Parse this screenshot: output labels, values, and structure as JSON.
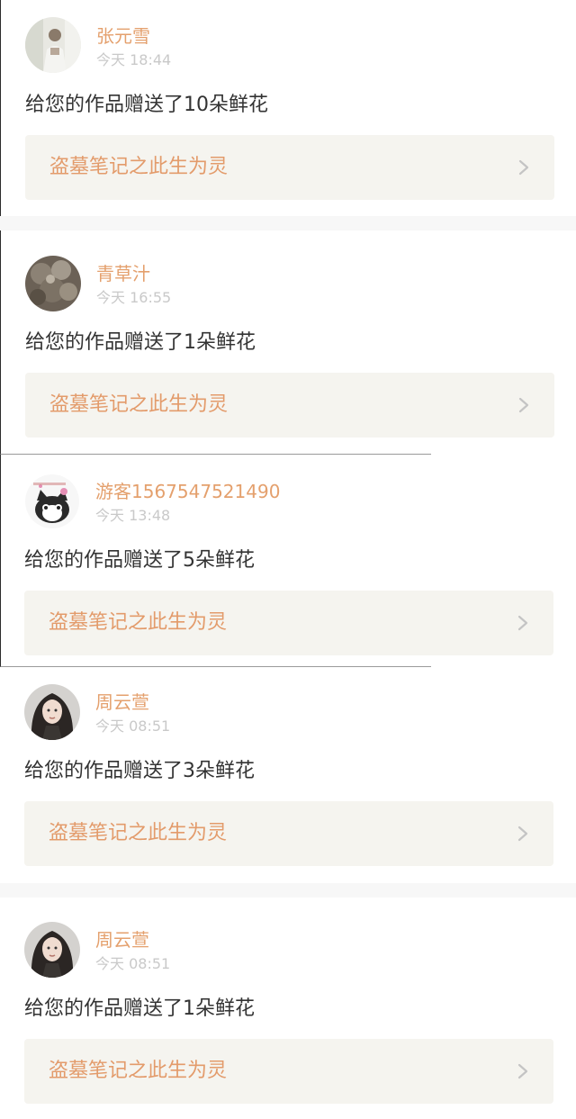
{
  "notifications": [
    {
      "user": "张元雪",
      "time": "今天 18:44",
      "message": "给您的作品赠送了10朵鲜花",
      "work": "盗墓笔记之此生为灵",
      "avatar": "portrait-man-avatar"
    },
    {
      "user": "青草汁",
      "time": "今天 16:55",
      "message": "给您的作品赠送了1朵鲜花",
      "work": "盗墓笔记之此生为灵",
      "avatar": "dried-flowers-avatar"
    },
    {
      "user": "游客1567547521490",
      "time": "今天 13:48",
      "message": "给您的作品赠送了5朵鲜花",
      "work": "盗墓笔记之此生为灵",
      "avatar": "cartoon-cat-avatar"
    },
    {
      "user": "周云萱",
      "time": "今天 08:51",
      "message": "给您的作品赠送了3朵鲜花",
      "work": "盗墓笔记之此生为灵",
      "avatar": "girl-portrait-avatar"
    },
    {
      "user": "周云萱",
      "time": "今天 08:51",
      "message": "给您的作品赠送了1朵鲜花",
      "work": "盗墓笔记之此生为灵",
      "avatar": "girl-portrait-avatar"
    }
  ],
  "colors": {
    "username": "#e4a06d",
    "work_title": "#e39b6b",
    "timestamp": "#c9c9c9",
    "message": "#333333",
    "card_background": "#f5f4ef",
    "separator": "#f7f7f7"
  },
  "icons": {
    "chevron": "chevron-right-icon"
  }
}
